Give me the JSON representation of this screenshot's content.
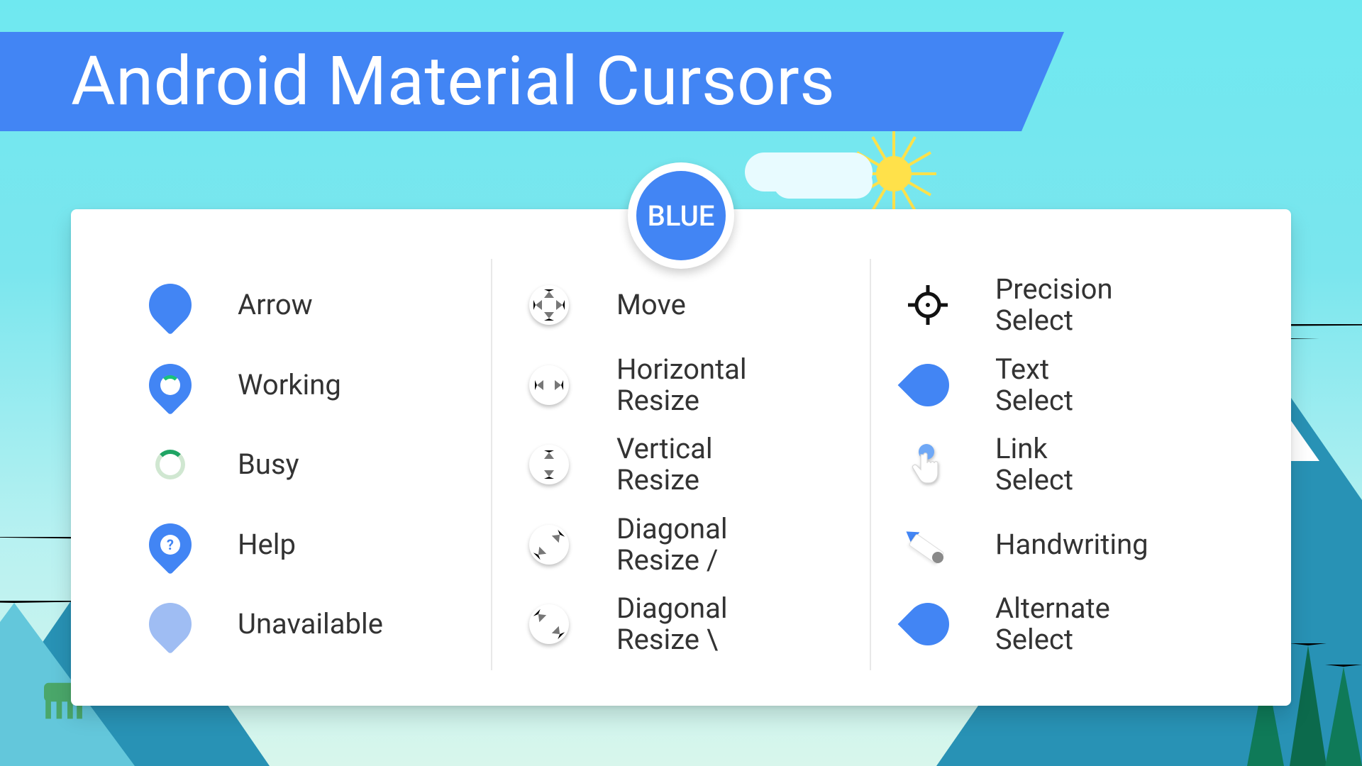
{
  "title": "Android Material Cursors",
  "theme": {
    "name": "BLUE",
    "accent": "#4285f4"
  },
  "columns": [
    {
      "items": [
        {
          "icon": "arrow-cursor-icon",
          "label": "Arrow"
        },
        {
          "icon": "working-cursor-icon",
          "label": "Working"
        },
        {
          "icon": "busy-cursor-icon",
          "label": "Busy"
        },
        {
          "icon": "help-cursor-icon",
          "label": "Help"
        },
        {
          "icon": "unavailable-cursor-icon",
          "label": "Unavailable"
        }
      ]
    },
    {
      "items": [
        {
          "icon": "move-cursor-icon",
          "label": "Move"
        },
        {
          "icon": "horizontal-resize-cursor-icon",
          "label": "Horizontal\nResize"
        },
        {
          "icon": "vertical-resize-cursor-icon",
          "label": "Vertical\nResize"
        },
        {
          "icon": "diagonal-resize-1-cursor-icon",
          "label": "Diagonal\nResize /"
        },
        {
          "icon": "diagonal-resize-2-cursor-icon",
          "label": "Diagonal\nResize \\"
        }
      ]
    },
    {
      "items": [
        {
          "icon": "precision-select-cursor-icon",
          "label": "Precision\nSelect"
        },
        {
          "icon": "text-select-cursor-icon",
          "label": "Text\nSelect"
        },
        {
          "icon": "link-select-cursor-icon",
          "label": "Link\nSelect"
        },
        {
          "icon": "handwriting-cursor-icon",
          "label": "Handwriting"
        },
        {
          "icon": "alternate-select-cursor-icon",
          "label": "Alternate\nSelect"
        }
      ]
    }
  ]
}
